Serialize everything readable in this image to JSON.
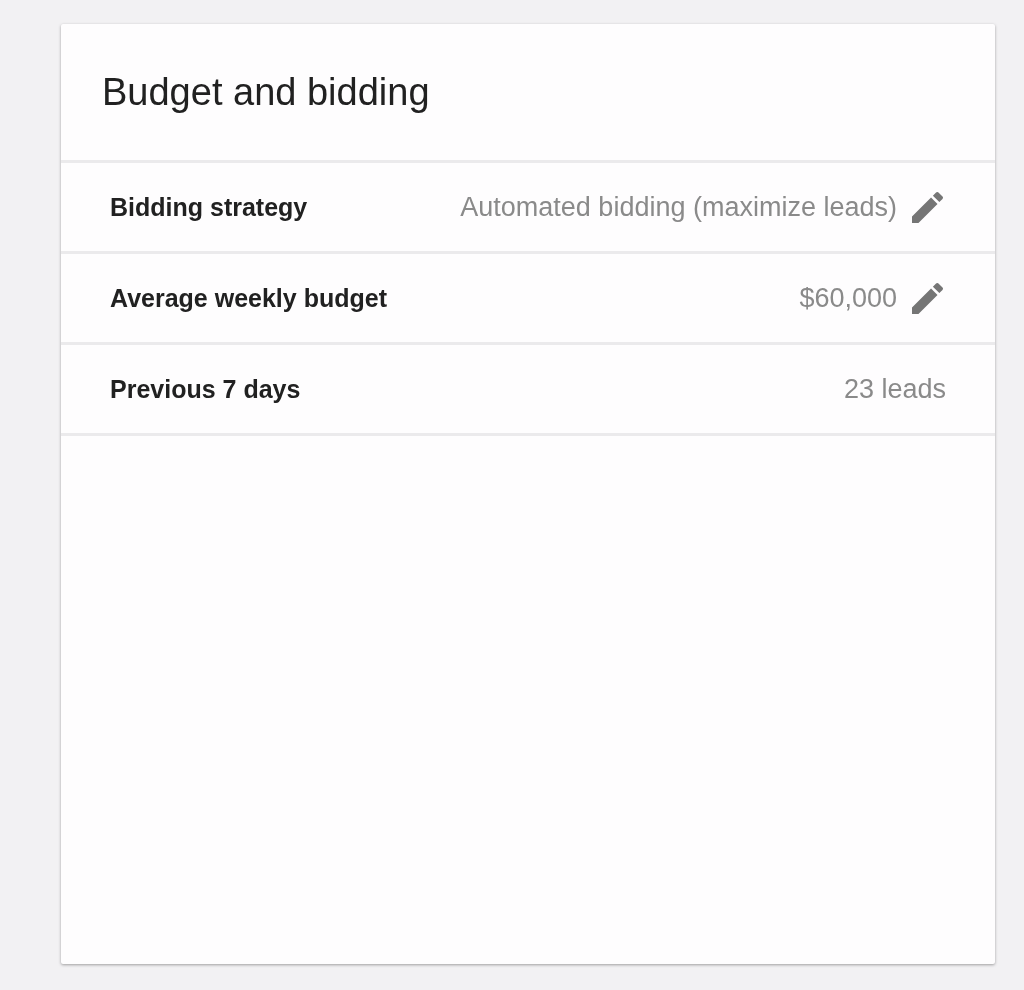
{
  "card": {
    "title": "Budget and bidding",
    "rows": [
      {
        "label": "Bidding strategy",
        "value": "Automated bidding (maximize leads)",
        "editable": true
      },
      {
        "label": "Average weekly budget",
        "value": "$60,000",
        "editable": true
      },
      {
        "label": "Previous 7 days",
        "value": "23 leads",
        "editable": false
      }
    ]
  }
}
